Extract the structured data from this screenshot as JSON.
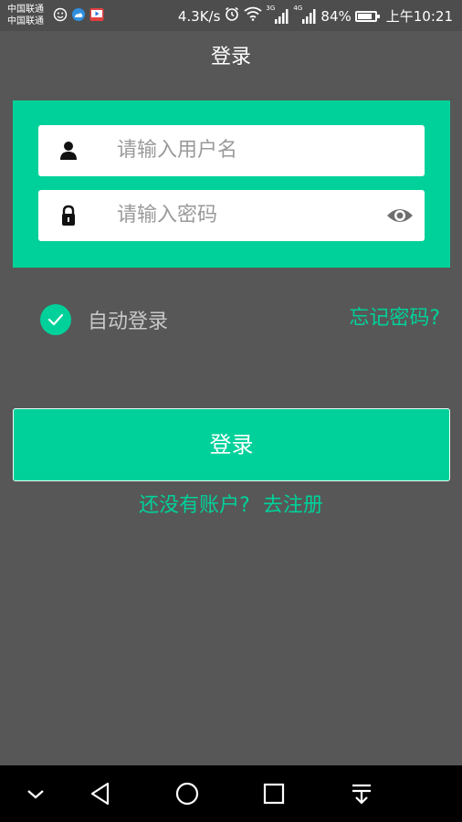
{
  "status_bar": {
    "carrier_1": "中国联通",
    "carrier_2": "中国联通",
    "network_speed": "4.3K/s",
    "signal_1_label": "3G",
    "signal_2_label": "4G",
    "battery_percent": "84%",
    "battery_level": 0.84,
    "time": "上午10:21",
    "icons": [
      "face-icon",
      "weather-icon",
      "video-app-icon",
      "alarm-icon",
      "wifi-icon",
      "signal-icon",
      "battery-icon"
    ]
  },
  "header": {
    "title": "登录"
  },
  "form": {
    "username_placeholder": "请输入用户名",
    "password_placeholder": "请输入密码",
    "icons": {
      "username": "user-icon",
      "password": "lock-icon",
      "reveal": "eye-icon"
    }
  },
  "options": {
    "auto_login_label": "自动登录",
    "auto_login_checked": true,
    "forgot_password": "忘记密码?"
  },
  "actions": {
    "login_button": "登录",
    "register_prompt": "还没有账户?",
    "register_link": "去注册"
  },
  "nav_bar": {
    "icons": [
      "chevron-down-icon",
      "back-icon",
      "home-icon",
      "recents-icon",
      "notification-pull-icon"
    ]
  },
  "colors": {
    "accent": "#00d19a",
    "background": "#575757",
    "nav_background": "#000000"
  }
}
